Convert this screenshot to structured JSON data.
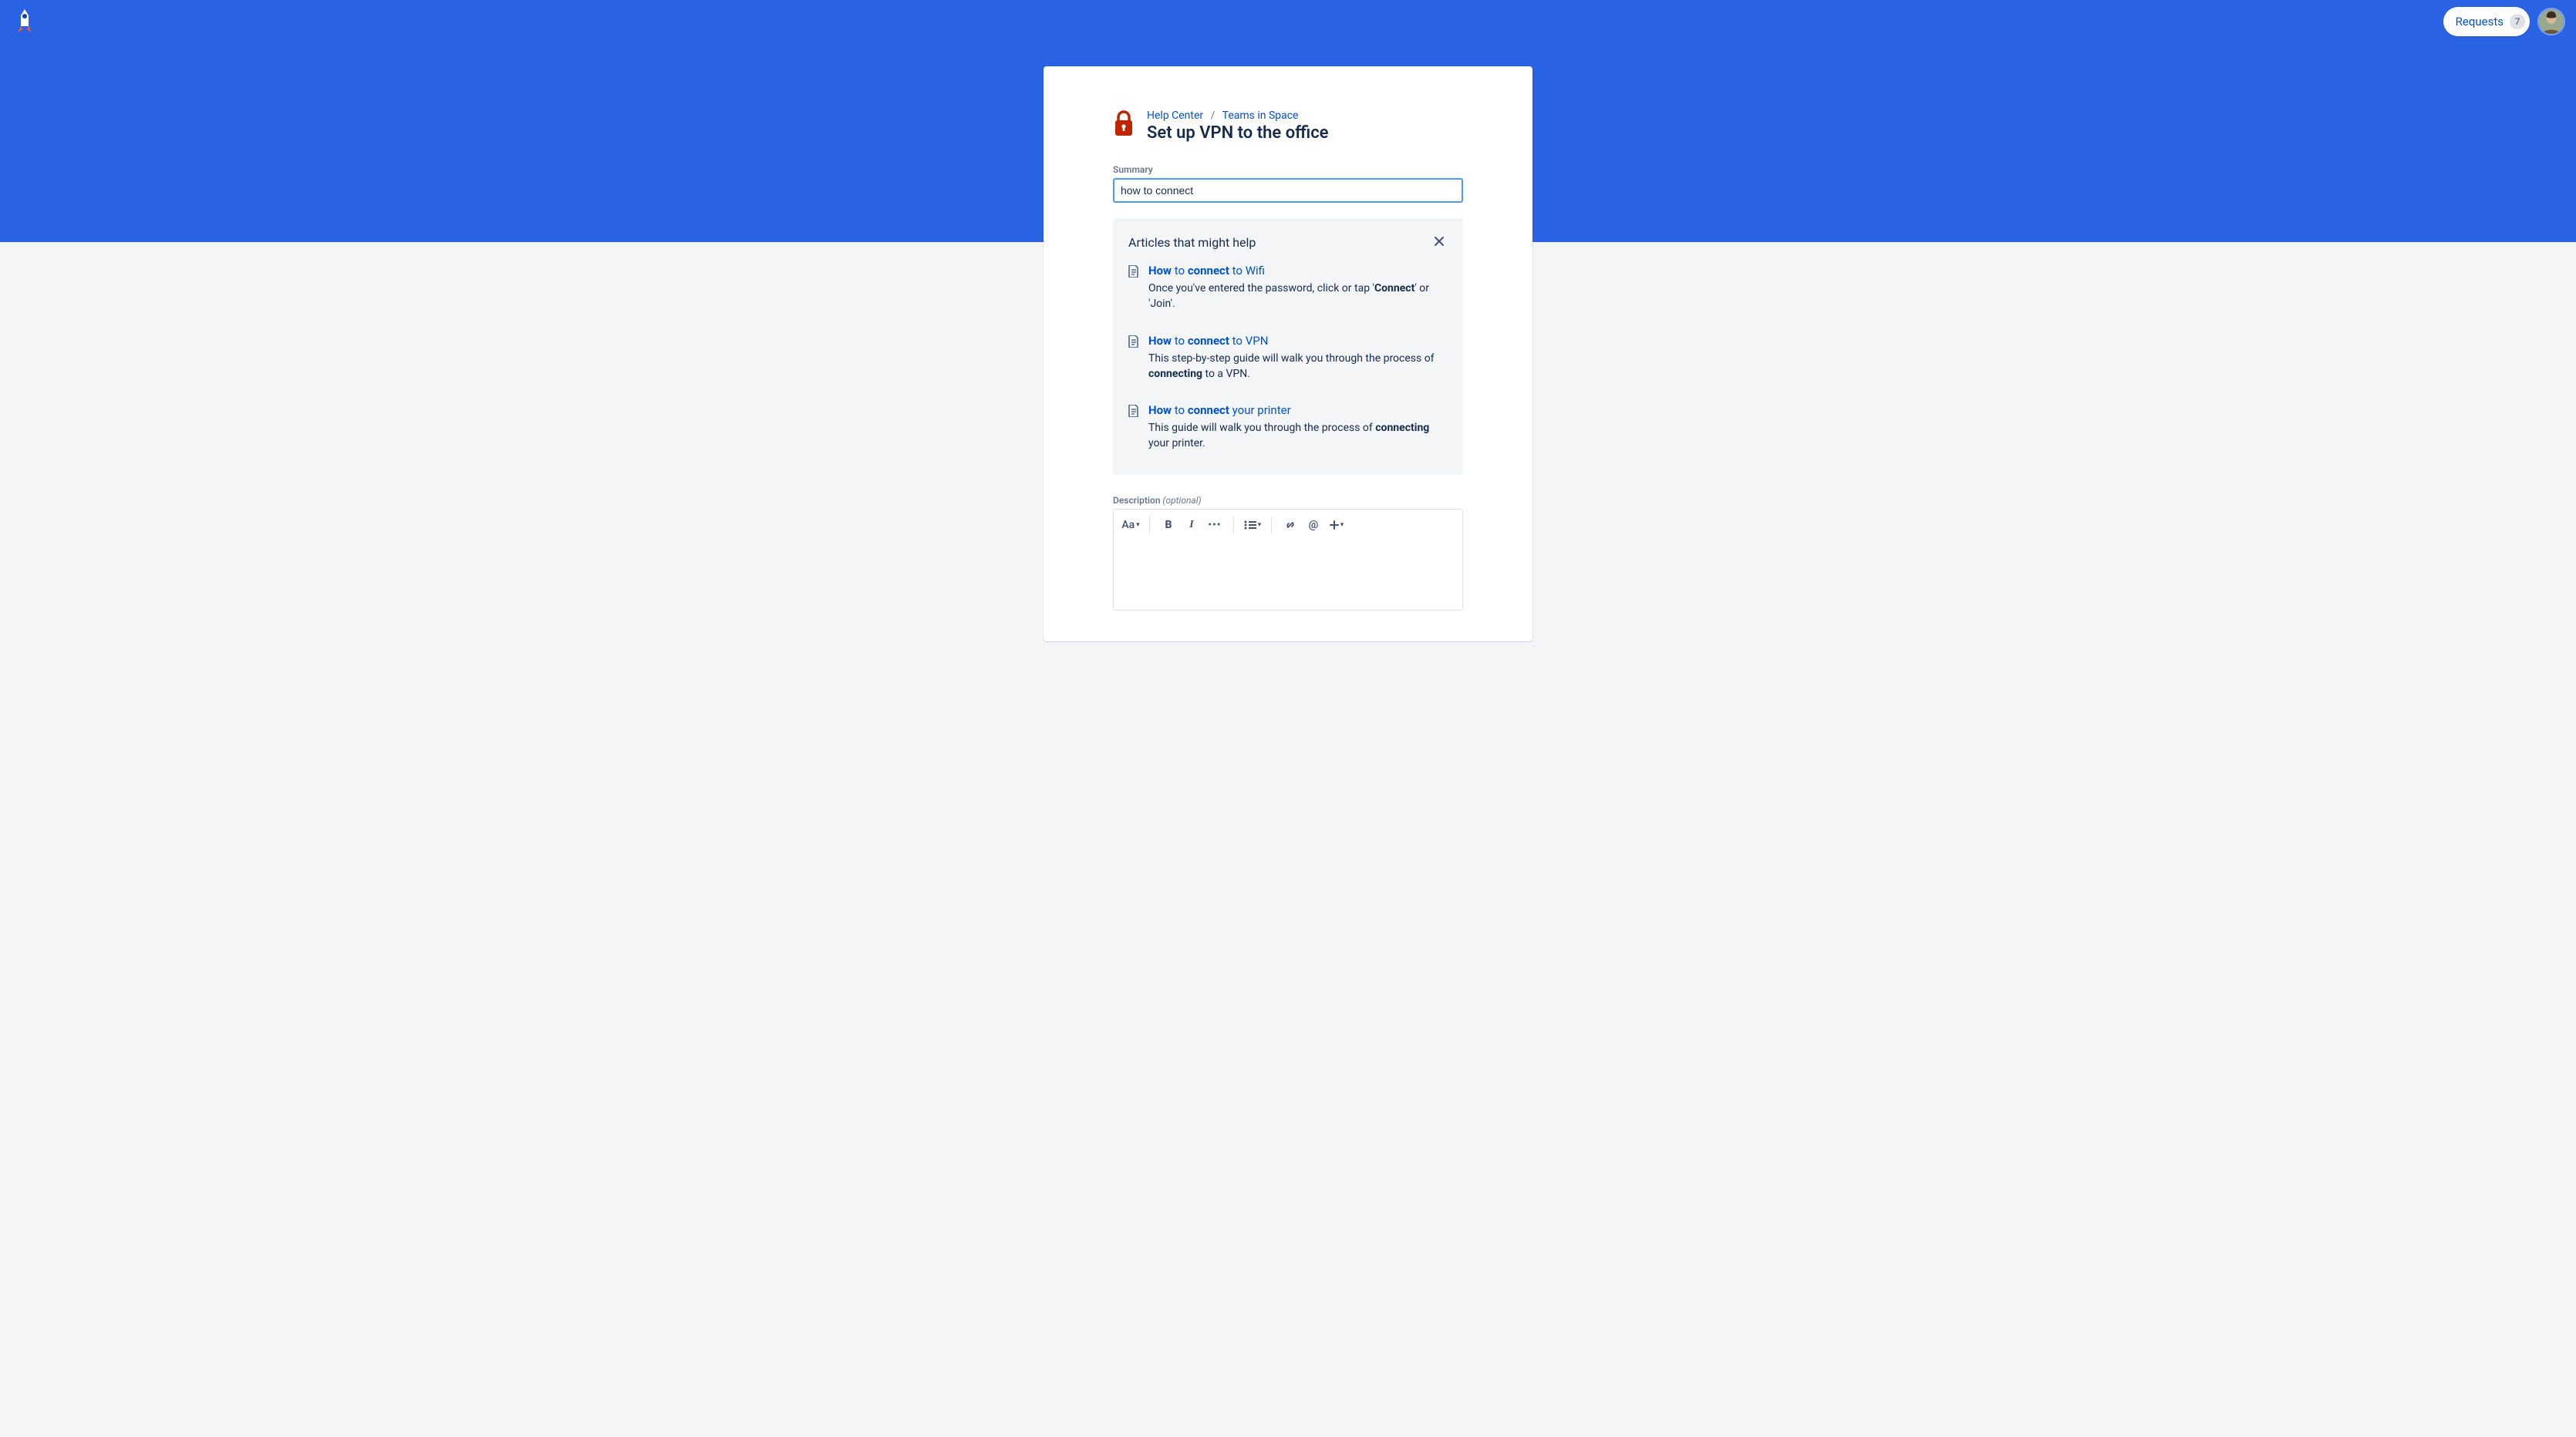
{
  "header": {
    "requests_label": "Requests",
    "requests_count": "7"
  },
  "breadcrumb": {
    "root": "Help Center",
    "project": "Teams in Space"
  },
  "page": {
    "title": "Set up VPN to the office"
  },
  "summary": {
    "label": "Summary",
    "value": "how to connect"
  },
  "suggestions": {
    "heading": "Articles that might help",
    "items": [
      {
        "title_pre": "How",
        "title_mid": " to ",
        "title_bold": "connect",
        "title_post": " to Wifi",
        "snippet_pre": "Once you've entered the password, click or tap '",
        "snippet_bold": "Connect",
        "snippet_post": "' or 'Join'."
      },
      {
        "title_pre": "How",
        "title_mid": " to ",
        "title_bold": "connect",
        "title_post": " to VPN",
        "snippet_pre": "This step-by-step guide will walk you through the process of ",
        "snippet_bold": "connecting",
        "snippet_post": " to a VPN."
      },
      {
        "title_pre": "How",
        "title_mid": " to ",
        "title_bold": "connect",
        "title_post": " your printer",
        "snippet_pre": "This guide will walk you through the process of ",
        "snippet_bold": "connecting",
        "snippet_post": " your printer."
      }
    ]
  },
  "description": {
    "label": "Description",
    "optional": "(optional)",
    "toolbar": {
      "text_style": "Aa"
    }
  }
}
